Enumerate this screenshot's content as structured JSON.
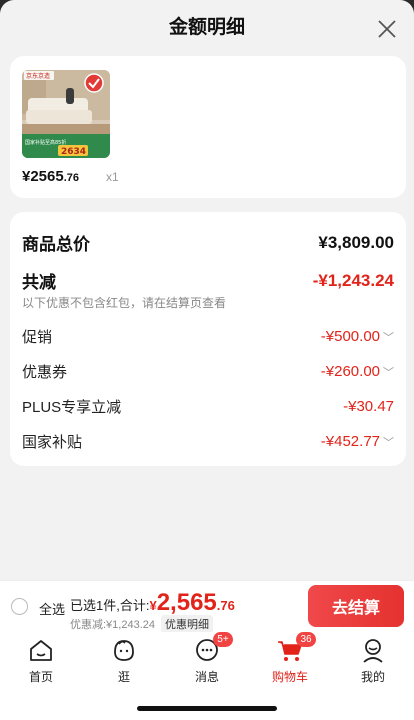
{
  "sheet": {
    "title": "金额明细"
  },
  "product": {
    "price_int": "¥2565",
    "price_dec": ".76",
    "qty": "x1",
    "thumb_brand": "京东京造",
    "thumb_price": "2634",
    "thumb_promo": "国家补贴至高85折"
  },
  "summary": {
    "total_label": "商品总价",
    "total_value": "¥3,809.00",
    "discount_label": "共减",
    "discount_value": "-¥1,243.24",
    "note": "以下优惠不包含红包，请在结算页查看",
    "items": [
      {
        "label": "促销",
        "value": "-¥500.00"
      },
      {
        "label": "优惠券",
        "value": "-¥260.00"
      },
      {
        "label": "PLUS专享立减",
        "value": "-¥30.47"
      },
      {
        "label": "国家补贴",
        "value": "-¥452.77"
      }
    ]
  },
  "cart": {
    "select_all": "全选",
    "selected_text": "已选1件,合计:",
    "currency": "¥",
    "total_int": "2,565",
    "total_dec": ".76",
    "discount_text": "优惠减:¥1,243.24",
    "detail_tag": "优惠明细",
    "checkout": "去结算"
  },
  "tabs": [
    {
      "label": "首页",
      "icon": "home-icon"
    },
    {
      "label": "逛",
      "icon": "face-icon"
    },
    {
      "label": "消息",
      "icon": "message-icon",
      "badge": "5+"
    },
    {
      "label": "购物车",
      "icon": "cart-icon",
      "badge": "36",
      "active": true
    },
    {
      "label": "我的",
      "icon": "person-icon"
    }
  ],
  "colors": {
    "accent": "#e2231a",
    "checkout_bg": "#ec3f3f",
    "sheet_bg": "#f2f2f2"
  }
}
